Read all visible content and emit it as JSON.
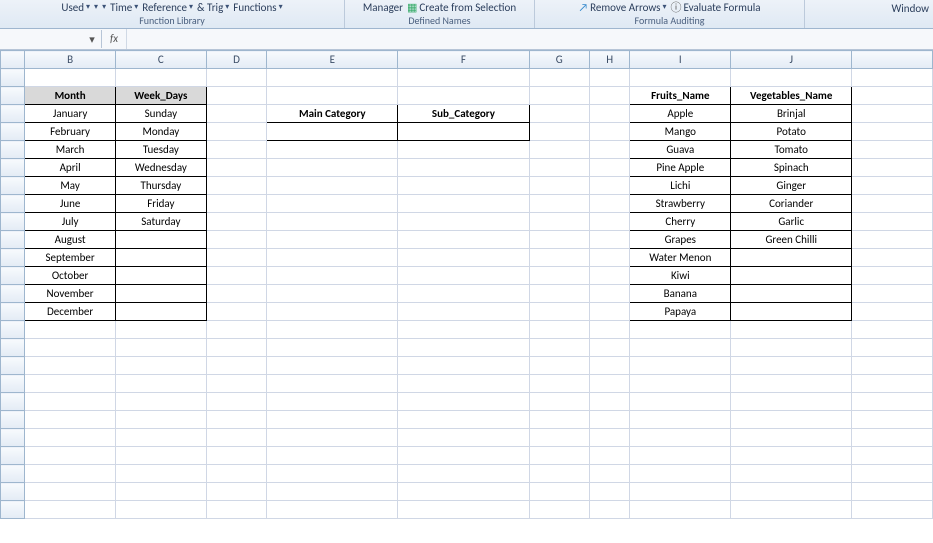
{
  "ribbon": {
    "funclib": {
      "used": "Used",
      "time": "Time",
      "reference": "Reference",
      "trig": "& Trig",
      "functions": "Functions",
      "label": "Function Library"
    },
    "definednames": {
      "manager": "Manager",
      "create": "Create from Selection",
      "label": "Defined Names"
    },
    "auditing": {
      "remove": "Remove Arrows",
      "evaluate": "Evaluate Formula",
      "label": "Formula Auditing"
    },
    "window": "Window"
  },
  "fx": {
    "symbol": "fx",
    "value": ""
  },
  "cols": [
    "B",
    "C",
    "D",
    "E",
    "F",
    "G",
    "H",
    "I",
    "J"
  ],
  "headers": {
    "month": "Month",
    "week": "Week_Days",
    "main": "Main Category",
    "sub": "Sub_Category",
    "fruits": "Fruits_Name",
    "veg": "Vegetables_Name"
  },
  "months": [
    "January",
    "February",
    "March",
    "April",
    "May",
    "June",
    "July",
    "August",
    "September",
    "October",
    "November",
    "December"
  ],
  "weekdays": [
    "Sunday",
    "Monday",
    "Tuesday",
    "Wednesday",
    "Thursday",
    "Friday",
    "Saturday"
  ],
  "fruits": [
    "Apple",
    "Mango",
    "Guava",
    "Pine Apple",
    "Lichi",
    "Strawberry",
    "Cherry",
    "Grapes",
    "Water Menon",
    "Kiwi",
    "Banana",
    "Papaya"
  ],
  "vegetables": [
    "Brinjal",
    "Potato",
    "Tomato",
    "Spinach",
    "Ginger",
    "Coriander",
    "Garlic",
    "Green Chilli"
  ]
}
